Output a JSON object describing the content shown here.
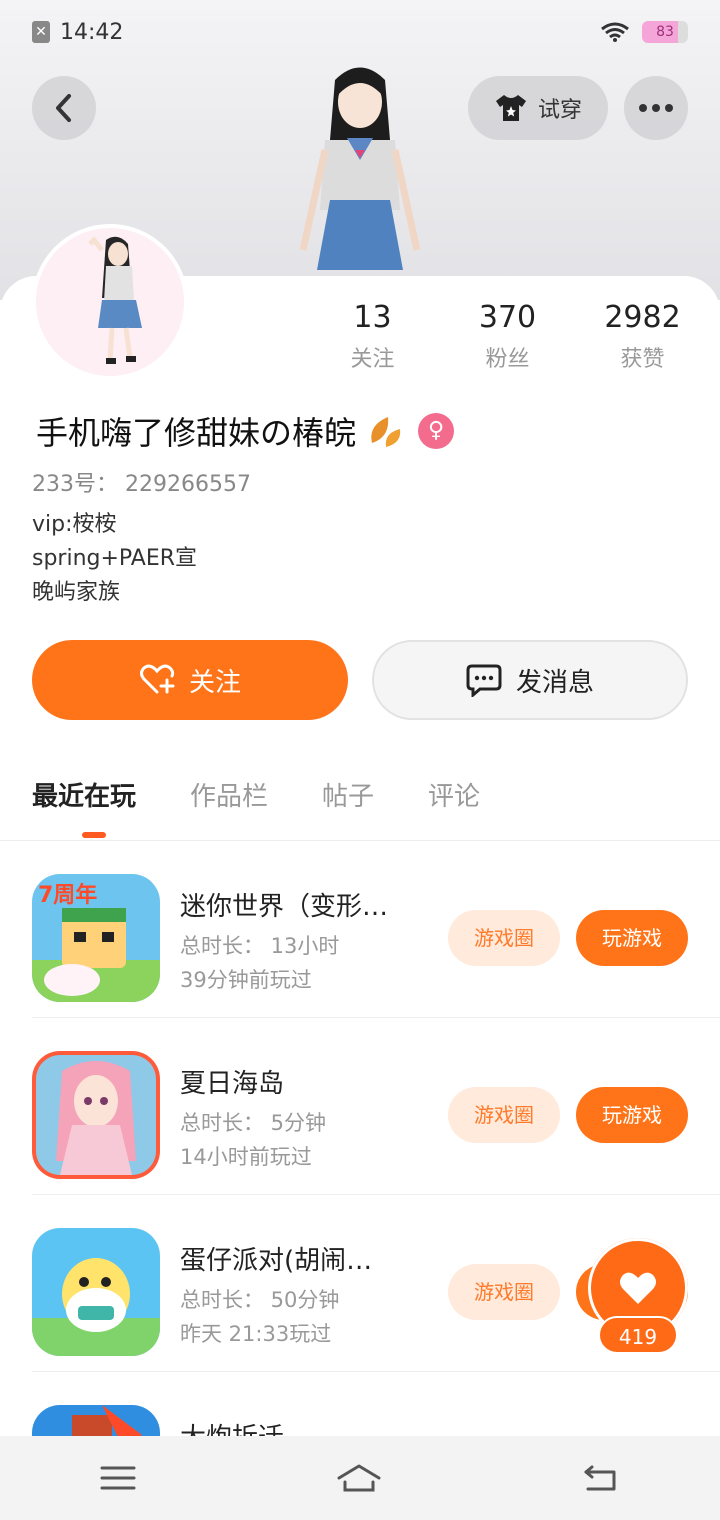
{
  "status_bar": {
    "time": "14:42",
    "battery": "83"
  },
  "header": {
    "try_on_label": "试穿"
  },
  "stats": [
    {
      "num": "13",
      "label": "关注"
    },
    {
      "num": "370",
      "label": "粉丝"
    },
    {
      "num": "2982",
      "label": "获赞"
    }
  ],
  "profile": {
    "username": "手机嗨了修甜妹の椿皖",
    "gender_symbol": "♀",
    "uid": "233号： 229266557",
    "bio_lines": [
      "vip:桉桉",
      "spring+PAER宣",
      "晚屿家族"
    ]
  },
  "actions": {
    "follow_label": "关注",
    "message_label": "发消息"
  },
  "tabs": [
    "最近在玩",
    "作品栏",
    "帖子",
    "评论"
  ],
  "games": [
    {
      "name": "迷你世界（变形…",
      "duration": "总时长： 13小时",
      "last_played": "39分钟前玩过",
      "circle_label": "游戏圈",
      "play_label": "玩游戏"
    },
    {
      "name": "夏日海岛",
      "duration": "总时长： 5分钟",
      "last_played": "14小时前玩过",
      "circle_label": "游戏圈",
      "play_label": "玩游戏"
    },
    {
      "name": "蛋仔派对(胡闹…",
      "duration": "总时长： 50分钟",
      "last_played": "昨天 21:33玩过",
      "circle_label": "游戏圈",
      "play_label": "玩游戏"
    },
    {
      "name": "大炮拆迁",
      "duration": "",
      "last_played": "",
      "circle_label": "",
      "play_label": ""
    }
  ],
  "like_fab": {
    "count": "419"
  },
  "colors": {
    "accent": "#ff7418",
    "accent_light": "#ffeadb",
    "gender": "#f36b8d"
  }
}
